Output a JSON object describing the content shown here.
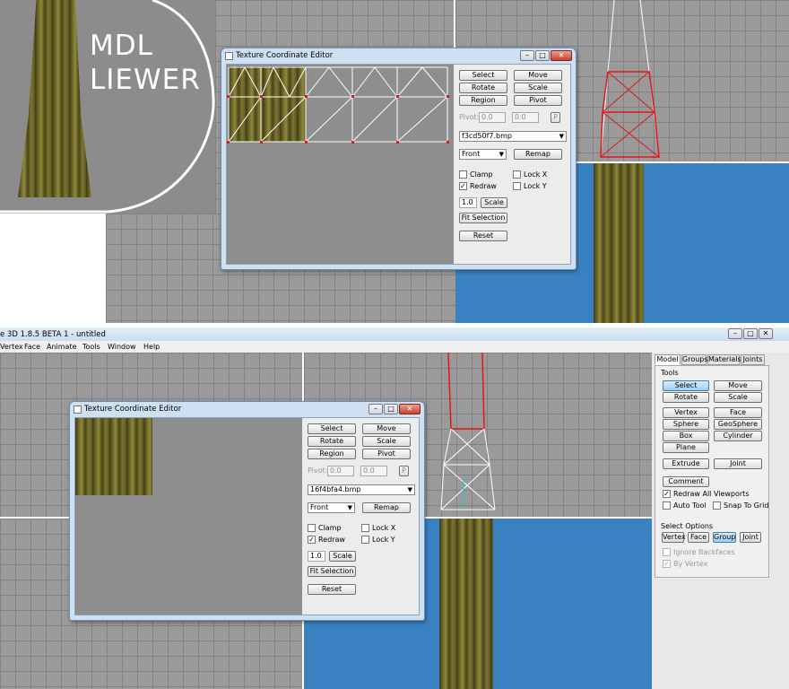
{
  "handwriting": "MDL LIEWER",
  "app_title": "e 3D 1.8.5 BETA 1 - untitled",
  "menu": [
    "Vertex",
    "Face",
    "Animate",
    "Tools",
    "Window",
    "Help"
  ],
  "tce_top": {
    "title": "Texture Coordinate Editor",
    "buttons": {
      "select": "Select",
      "move": "Move",
      "rotate": "Rotate",
      "scale": "Scale",
      "region": "Region",
      "pivot": "Pivot",
      "remap": "Remap",
      "scale2": "Scale",
      "fit": "Fit Selection",
      "reset": "Reset"
    },
    "pivot_label": "Pivot:",
    "pivot_x": "0.0",
    "pivot_y": "0.0",
    "pivot_p": "P",
    "texture": "f3cd50f7.bmp",
    "view": "Front",
    "clamp": "Clamp",
    "redraw": "Redraw",
    "lockx": "Lock X",
    "locky": "Lock Y",
    "scale_value": "1.0"
  },
  "tce_bottom": {
    "title": "Texture Coordinate Editor",
    "buttons": {
      "select": "Select",
      "move": "Move",
      "rotate": "Rotate",
      "scale": "Scale",
      "region": "Region",
      "pivot": "Pivot",
      "remap": "Remap",
      "scale2": "Scale",
      "fit": "Fit Selection",
      "reset": "Reset"
    },
    "pivot_label": "Pivot:",
    "pivot_x": "0.0",
    "pivot_y": "0.0",
    "pivot_p": "P",
    "texture": "16f4bfa4.bmp",
    "view": "Front",
    "clamp": "Clamp",
    "redraw": "Redraw",
    "lockx": "Lock X",
    "locky": "Lock Y",
    "scale_value": "1.0"
  },
  "panel": {
    "tabs": [
      "Model",
      "Groups",
      "Materials",
      "Joints"
    ],
    "tools_label": "Tools",
    "tools": {
      "select": "Select",
      "move": "Move",
      "rotate": "Rotate",
      "scale": "Scale",
      "vertex": "Vertex",
      "face": "Face",
      "sphere": "Sphere",
      "geosphere": "GeoSphere",
      "box": "Box",
      "cylinder": "Cylinder",
      "plane": "Plane",
      "extrude": "Extrude",
      "joint": "Joint",
      "comment": "Comment"
    },
    "redraw_all": "Redraw All Viewports",
    "auto_tool": "Auto Tool",
    "snap_grid": "Snap To Grid",
    "select_options_label": "Select Options",
    "select_options": {
      "vertex": "Vertex",
      "face": "Face",
      "group": "Group",
      "joint": "Joint"
    },
    "ignore_backfaces": "Ignore Backfaces",
    "by_vertex": "By Vertex"
  },
  "colors": {
    "accent_red": "#e01818",
    "viewport_blue": "#3a81c1",
    "grid_gray": "#9a9a9a"
  }
}
